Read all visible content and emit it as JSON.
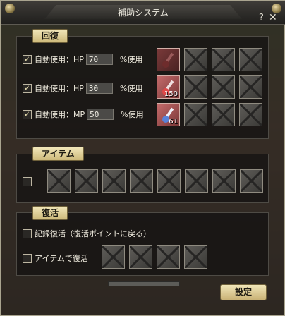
{
  "window": {
    "title": "補助システム",
    "help": "?",
    "close": "✕"
  },
  "recovery": {
    "label": "回復",
    "rows": [
      {
        "checked": true,
        "text": "自動使用：HP",
        "value": "70",
        "suffix": "%使用",
        "first_slot": {
          "item": "hp-potion",
          "count": ""
        }
      },
      {
        "checked": true,
        "text": "自動使用：HP",
        "value": "30",
        "suffix": "%使用",
        "first_slot": {
          "item": "hp-potion",
          "count": "150"
        }
      },
      {
        "checked": true,
        "text": "自動使用：MP",
        "value": "50",
        "suffix": "%使用",
        "first_slot": {
          "item": "mp-potion",
          "count": "61"
        }
      }
    ]
  },
  "item": {
    "label": "アイテム",
    "checked": false
  },
  "revive": {
    "label": "復活",
    "option1": "記録復活（復活ポイントに戻る）",
    "option2": "アイテムで復活",
    "option1_checked": false,
    "option2_checked": false
  },
  "buttons": {
    "confirm": "設定"
  },
  "colors": {
    "accent": "#e4d49a",
    "hp_potion": "#c46b6b",
    "mp_potion": "#7fa0d8"
  },
  "icons": {
    "check": "✓"
  }
}
